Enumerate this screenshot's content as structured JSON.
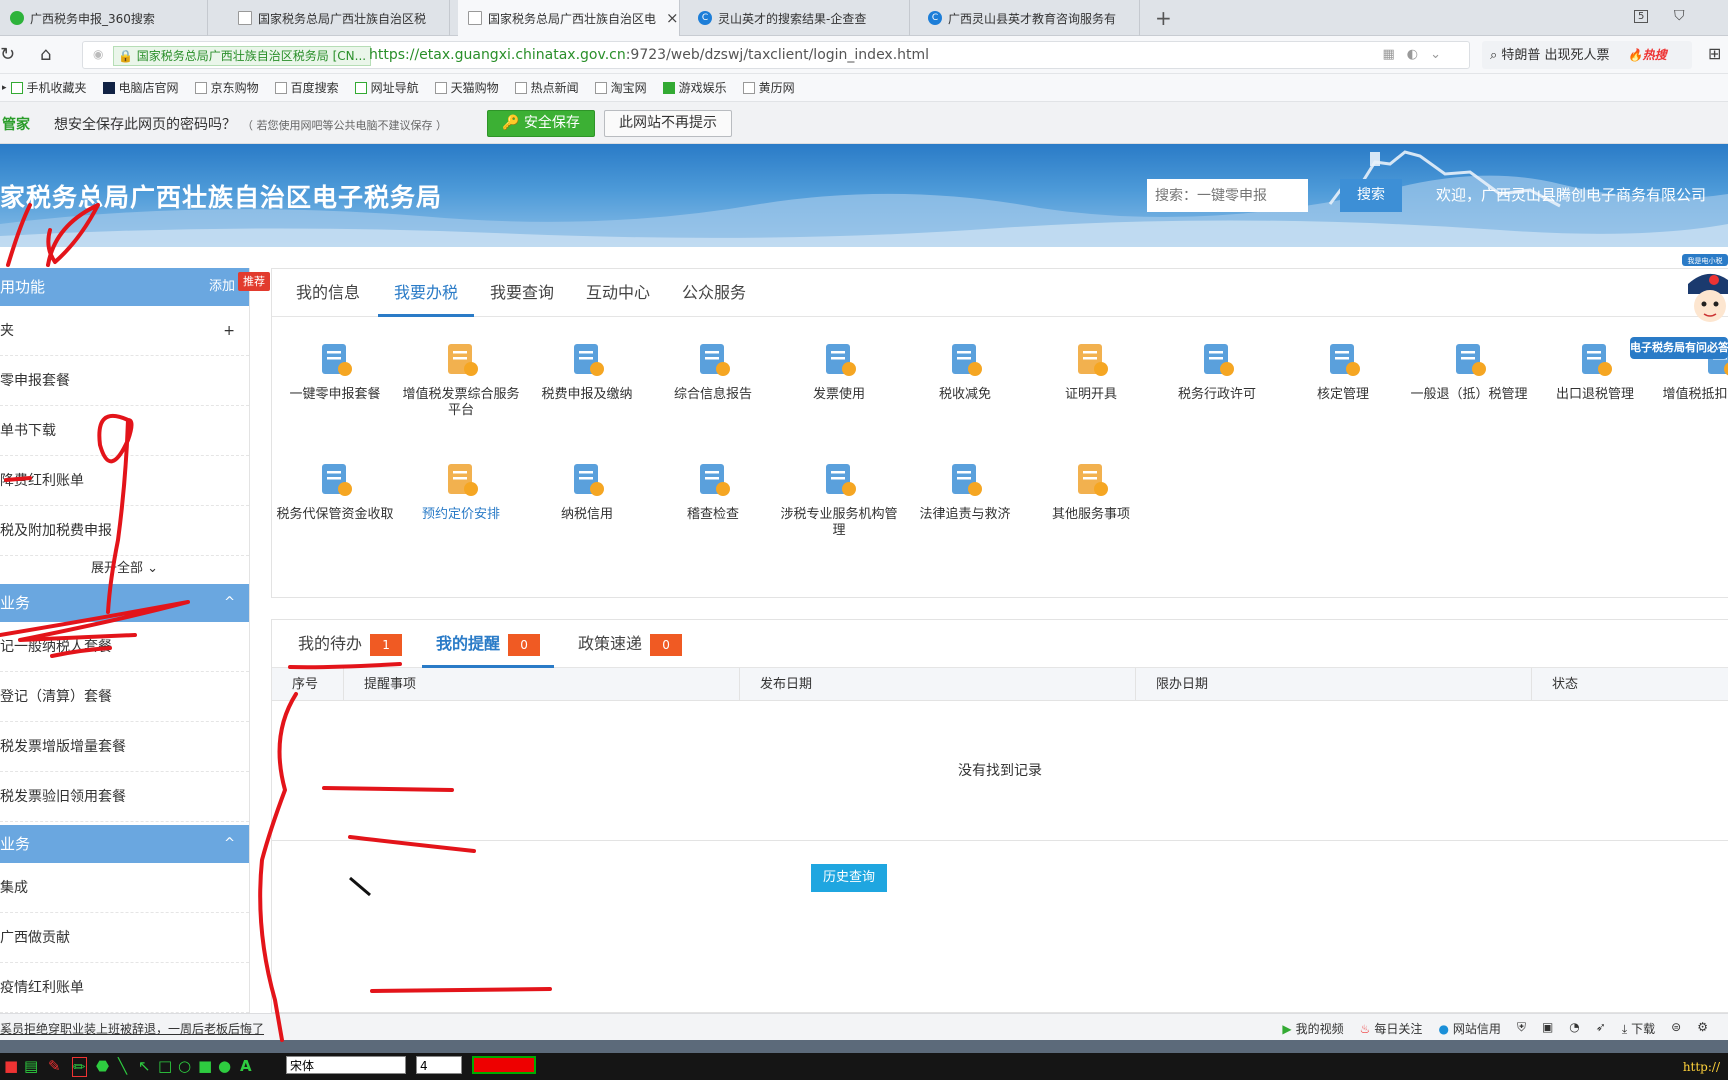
{
  "browser": {
    "tabs": [
      {
        "label": "广西税务申报_360搜索",
        "active": false
      },
      {
        "label": "国家税务总局广西壮族自治区税",
        "active": false
      },
      {
        "label": "国家税务总局广西壮族自治区电",
        "active": true
      },
      {
        "label": "灵山英才的搜索结果-企查查",
        "active": false
      },
      {
        "label": "广西灵山县英才教育咨询服务有",
        "active": false
      }
    ],
    "tab_count_badge": "5",
    "secure_chip": "国家税务总局广西壮族自治区税务局 [CN...",
    "url_host": "https://etax.guangxi.chinatax.gov.cn",
    "url_rest": ":9723/web/dzswj/taxclient/login_index.html",
    "search_text": "特朗普 出现死人票",
    "search_hot": "热搜",
    "bookmarks": [
      "手机收藏夹",
      "电脑店官网",
      "京东购物",
      "百度搜索",
      "网址导航",
      "天猫购物",
      "热点新闻",
      "淘宝网",
      "游戏娱乐",
      "黄历网"
    ]
  },
  "password_bar": {
    "brand": "管家",
    "question": "想安全保存此网页的密码吗？",
    "note": "（ 若您使用网吧等公共电脑不建议保存 ）",
    "save_label": "安全保存",
    "no_ask_label": "此网站不再提示"
  },
  "site": {
    "title": "家税务总局广西壮族自治区电子税务局",
    "search_placeholder": "搜索：一键零申报",
    "search_button": "搜索",
    "welcome": "欢迎，广西灵山县腾创电子商务有限公司"
  },
  "sidebar": {
    "section1": {
      "title": "用功能",
      "action": "添加"
    },
    "section1_items": [
      "夹",
      "零申报套餐",
      "单书下载",
      "降费红利账单",
      "税及附加税费申报"
    ],
    "folder_plus": "+",
    "expand_all": "展开全部",
    "section2": {
      "title": "业务",
      "chevron": "^"
    },
    "section2_items": [
      "记一般纳税人套餐",
      "登记（清算）套餐",
      "税发票增版增量套餐",
      "税发票验旧领用套餐"
    ],
    "section3": {
      "title": "业务",
      "chevron": "^"
    },
    "section3_items": [
      "集成",
      "广西做贡献",
      "疫情红利账单"
    ],
    "recommend_tag": "推荐"
  },
  "main": {
    "tabs": [
      "我的信息",
      "我要办税",
      "我要查询",
      "互动中心",
      "公众服务"
    ],
    "active_tab": 1,
    "services_row1": [
      "一键零申报套餐",
      "增值税发票综合服务平台",
      "税费申报及缴纳",
      "综合信息报告",
      "发票使用",
      "税收减免",
      "证明开具",
      "税务行政许可",
      "核定管理",
      "一般退（抵）税管理",
      "出口退税管理",
      "增值税抵扣凭证管理"
    ],
    "services_row2": [
      "税务代保管资金收取",
      "预约定价安排",
      "纳税信用",
      "稽查检查",
      "涉税专业服务机构管理",
      "法律追责与救济",
      "其他服务事项"
    ]
  },
  "reminders": {
    "tabs": [
      {
        "label": "我的待办",
        "count": "1"
      },
      {
        "label": "我的提醒",
        "count": "0"
      },
      {
        "label": "政策速递",
        "count": "0"
      }
    ],
    "columns": [
      "序号",
      "提醒事项",
      "发布日期",
      "限办日期",
      "状态"
    ],
    "empty_text": "没有找到记录",
    "history_button": "历史查询"
  },
  "mascot": {
    "top_label": "我是电小税",
    "banner": "电子税务局有问必答"
  },
  "statusbar": {
    "news": "奚员拒绝穿职业装上班被辞退，一周后老板后悔了",
    "items": [
      "我的视频",
      "每日关注",
      "网站信用",
      "下载"
    ]
  },
  "drawbar": {
    "font": "宋体",
    "size": "4",
    "pen_color": "#e00000",
    "tip": "http://"
  },
  "colors": {
    "brand_blue": "#2a7bc7",
    "sidebar_header": "#6aa7e0",
    "badge_orange": "#f05a23",
    "save_green": "#3cb034",
    "annotation_red": "#e3141a"
  }
}
